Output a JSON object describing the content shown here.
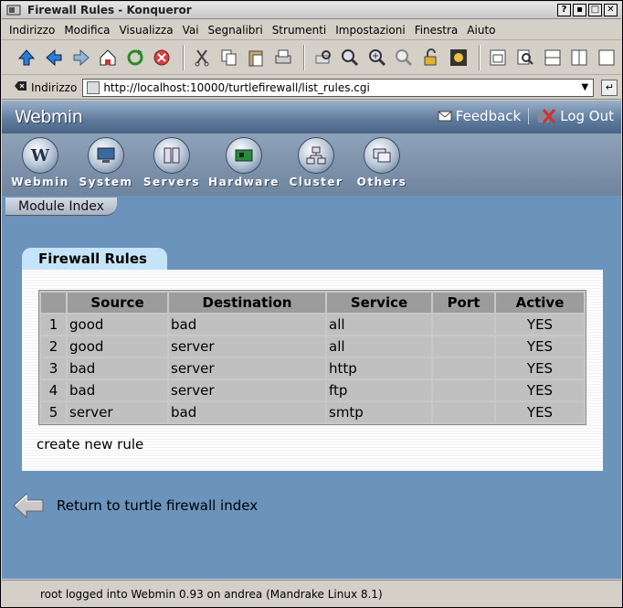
{
  "window": {
    "title": "Firewall Rules - Konqueror",
    "buttons": [
      "?",
      "▪",
      "□",
      "✕"
    ]
  },
  "menu": [
    "Indirizzo",
    "Modifica",
    "Visualizza",
    "Vai",
    "Segnalibri",
    "Strumenti",
    "Impostazioni",
    "Finestra",
    "Aiuto"
  ],
  "location": {
    "label": "Indirizzo",
    "url": "http://localhost:10000/turtlefirewall/list_rules.cgi"
  },
  "webmin": {
    "logo": "Webmin",
    "feedback": "Feedback",
    "logout": "Log Out",
    "categories": [
      "Webmin",
      "System",
      "Servers",
      "Hardware",
      "Cluster",
      "Others"
    ],
    "module_index": "Module Index"
  },
  "panel": {
    "title": "Firewall Rules",
    "headers": [
      "",
      "Source",
      "Destination",
      "Service",
      "Port",
      "Active"
    ],
    "rows": [
      {
        "num": "1",
        "source": "good",
        "destination": "bad",
        "service": "all",
        "port": "",
        "active": "YES"
      },
      {
        "num": "2",
        "source": "good",
        "destination": "server",
        "service": "all",
        "port": "",
        "active": "YES"
      },
      {
        "num": "3",
        "source": "bad",
        "destination": "server",
        "service": "http",
        "port": "",
        "active": "YES"
      },
      {
        "num": "4",
        "source": "bad",
        "destination": "server",
        "service": "ftp",
        "port": "",
        "active": "YES"
      },
      {
        "num": "5",
        "source": "server",
        "destination": "bad",
        "service": "smtp",
        "port": "",
        "active": "YES"
      }
    ],
    "create_link": "create new rule"
  },
  "return_link": "Return to turtle firewall index",
  "status": "root logged into Webmin 0.93 on andrea (Mandrake Linux 8.1)"
}
